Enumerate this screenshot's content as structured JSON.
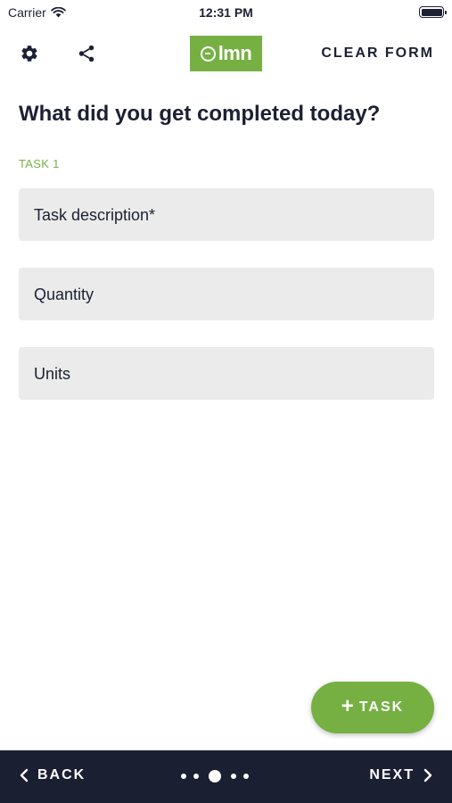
{
  "status_bar": {
    "carrier": "Carrier",
    "time": "12:31 PM",
    "battery_level": 1.0
  },
  "header": {
    "settings_icon": "gear-icon",
    "share_icon": "share-icon",
    "logo_text": "lmn",
    "clear_form_label": "CLEAR FORM"
  },
  "main": {
    "title": "What did you get completed today?",
    "task_label": "TASK 1",
    "fields": [
      {
        "label": "Task description*"
      },
      {
        "label": "Quantity"
      },
      {
        "label": "Units"
      }
    ],
    "add_task": {
      "icon": "+",
      "label": "TASK"
    }
  },
  "bottom_nav": {
    "back_label": "BACK",
    "next_label": "NEXT",
    "page_count": 5,
    "active_page": 3
  },
  "colors": {
    "brand_green": "#76b043",
    "nav_bg": "#1b1f32",
    "text_dark": "#1c2033",
    "field_bg": "#ebebeb"
  }
}
